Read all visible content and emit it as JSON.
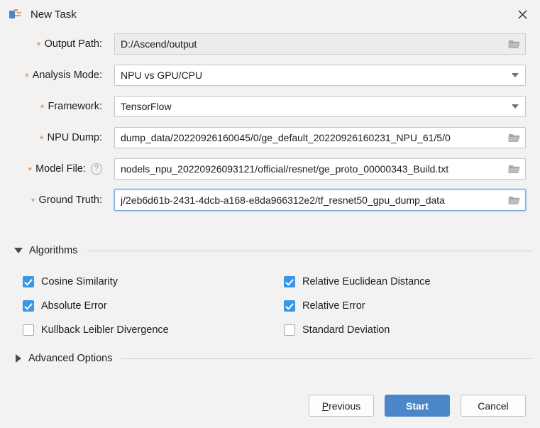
{
  "window": {
    "title": "New Task",
    "icon": "app-logo-icon",
    "close_label": "✕"
  },
  "form": {
    "fields": [
      {
        "label": "Output Path:",
        "required": true,
        "value": "D:/Ascend/output",
        "control": "text",
        "readonly": true,
        "trailing_icon": "folder-icon",
        "has_help": false,
        "focused": false
      },
      {
        "label": "Analysis Mode:",
        "required": true,
        "value": "NPU vs GPU/CPU",
        "control": "select",
        "readonly": false,
        "trailing_icon": "chevron-down-icon",
        "has_help": false,
        "focused": false
      },
      {
        "label": "Framework:",
        "required": true,
        "value": "TensorFlow",
        "control": "select",
        "readonly": false,
        "trailing_icon": "chevron-down-icon",
        "has_help": false,
        "focused": false
      },
      {
        "label": "NPU Dump:",
        "required": true,
        "value": "dump_data/20220926160045/0/ge_default_20220926160231_NPU_61/5/0",
        "control": "text",
        "readonly": false,
        "trailing_icon": "folder-icon",
        "has_help": false,
        "focused": false
      },
      {
        "label": "Model File:",
        "required": true,
        "value": "nodels_npu_20220926093121/official/resnet/ge_proto_00000343_Build.txt",
        "control": "text",
        "readonly": false,
        "trailing_icon": "folder-icon",
        "has_help": true,
        "help_icon": "help-circle-icon",
        "focused": false
      },
      {
        "label": "Ground Truth:",
        "required": true,
        "value": "j/2eb6d61b-2431-4dcb-a168-e8da966312e2/tf_resnet50_gpu_dump_data",
        "control": "text",
        "readonly": false,
        "trailing_icon": "folder-icon",
        "has_help": false,
        "focused": true
      }
    ]
  },
  "algorithms": {
    "section_title": "Algorithms",
    "expanded": true,
    "toggle_icon": "triangle-down-icon",
    "rows": [
      {
        "left": {
          "label": "Cosine Similarity",
          "checked": true
        },
        "right": {
          "label": "Relative Euclidean Distance",
          "checked": true
        }
      },
      {
        "left": {
          "label": "Absolute Error",
          "checked": true
        },
        "right": {
          "label": "Relative Error",
          "checked": true
        }
      },
      {
        "left": {
          "label": "Kullback Leibler Divergence",
          "checked": false
        },
        "right": {
          "label": "Standard Deviation",
          "checked": false
        }
      }
    ]
  },
  "advanced": {
    "section_title": "Advanced Options",
    "expanded": false,
    "toggle_icon": "triangle-right-icon"
  },
  "footer": {
    "previous_mnemonic": "P",
    "previous_rest": "revious",
    "start_label": "Start",
    "cancel_label": "Cancel"
  },
  "colors": {
    "background": "#f2f2f2",
    "accent": "#4a86c8",
    "checkbox_checked": "#3b97e3",
    "required_asterisk": "#e8883c",
    "focus_border": "#7fa8d8"
  }
}
